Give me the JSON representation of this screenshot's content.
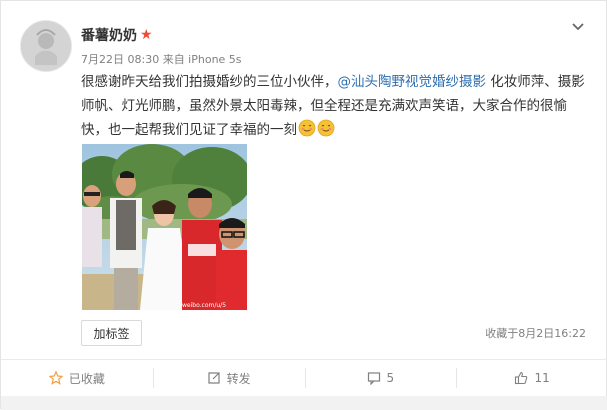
{
  "post": {
    "username": "番薯奶奶",
    "meta": "7月22日 08:30 来自 iPhone 5s",
    "content": {
      "part1": "很感谢昨天给我们拍摄婚纱的三位小伙伴，",
      "mention": "@汕头陶野视觉婚纱摄影",
      "part2": " 化妆师萍、摄影师帆、灯光师鹏，虽然外景太阳毒辣，但全程还是充满欢声笑语，大家合作的很愉快，也一起帮我们见证了幸福的一刻"
    },
    "tag_button": "加标签",
    "favorited_time": "收藏于8月2日16:22",
    "photo_watermark": "weibo.com/u/5"
  },
  "footer": {
    "favorite": "已收藏",
    "repost": "转发",
    "comments": "5",
    "likes": "11"
  },
  "colors": {
    "mention": "#2c6eb0",
    "star": "#f04b34",
    "favorite_star": "#f0a040"
  }
}
